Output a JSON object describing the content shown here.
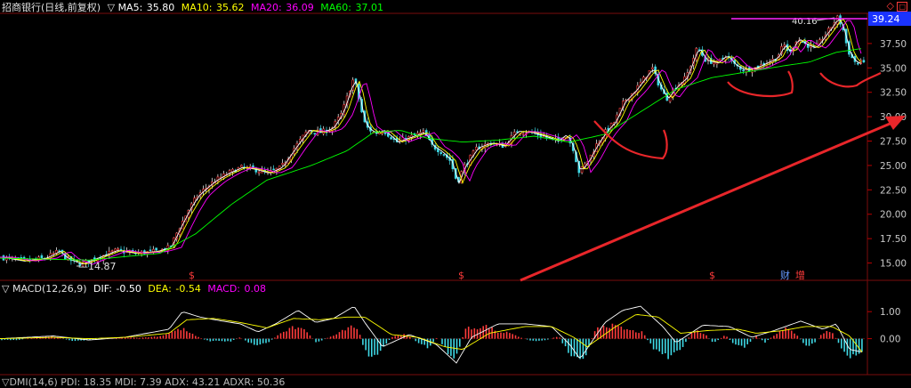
{
  "header": {
    "stock": "招商银行(日线,前复权)",
    "ma_toggle": "▽",
    "ma5_label": "MA5:",
    "ma5": "35.80",
    "ma10_label": "MA10:",
    "ma10": "35.62",
    "ma20_label": "MA20:",
    "ma20": "36.09",
    "ma60_label": "MA60:",
    "ma60": "37.01"
  },
  "macd_header": {
    "toggle": "▽",
    "name": "MACD(12,26,9)",
    "dif_label": "DIF:",
    "dif": "-0.50",
    "dea_label": "DEA:",
    "dea": "-0.54",
    "macd_label": "MACD:",
    "macd": "0.08"
  },
  "dmi_header": {
    "partial": "▽DMI(14,6) PDI: 18.35 MDI: 7.39 ADX: 43.21 ADXR: 50.36"
  },
  "price_box": "39.24",
  "high_label": "40.16",
  "low_label": "14.87",
  "markers": {
    "dividend": "$",
    "finance": "财",
    "increase": "增"
  },
  "colors": {
    "up": "#ff3b3b",
    "down": "#3fd9e6",
    "ma5": "#ffffff",
    "ma10": "#ffff00",
    "ma20": "#ff00ff",
    "ma60": "#00ff00",
    "dif": "#ffffff",
    "dea": "#ffff00",
    "annotation": "#e8262a",
    "grid": "#7a0b0b"
  },
  "chart_data": [
    {
      "type": "candlestick",
      "title": "招商银行(日线,前复权)",
      "ylim": [
        13.5,
        40.5
      ],
      "yticks": [
        15.0,
        17.5,
        20.0,
        22.5,
        25.0,
        27.5,
        30.0,
        32.5,
        35.0,
        37.5
      ],
      "ytick_labels": [
        "15.00",
        "17.50",
        "20.00",
        "22.50",
        "25.00",
        "27.50",
        "30.00",
        "32.50",
        "35.00",
        "37.50"
      ],
      "close_path": [
        [
          0,
          15.6
        ],
        [
          25,
          15.2
        ],
        [
          50,
          15.5
        ],
        [
          65,
          16.2
        ],
        [
          75,
          15.4
        ],
        [
          90,
          14.87
        ],
        [
          110,
          15.6
        ],
        [
          130,
          16.3
        ],
        [
          150,
          16.0
        ],
        [
          175,
          16.2
        ],
        [
          190,
          16.6
        ],
        [
          200,
          18.5
        ],
        [
          210,
          20.3
        ],
        [
          220,
          21.8
        ],
        [
          228,
          22.5
        ],
        [
          240,
          23.4
        ],
        [
          255,
          24.2
        ],
        [
          270,
          24.8
        ],
        [
          285,
          24.6
        ],
        [
          300,
          24.2
        ],
        [
          315,
          24.8
        ],
        [
          330,
          26.8
        ],
        [
          345,
          28.6
        ],
        [
          360,
          28.4
        ],
        [
          372,
          28.8
        ],
        [
          383,
          30.3
        ],
        [
          390,
          32.2
        ],
        [
          396,
          33.8
        ],
        [
          400,
          33.0
        ],
        [
          404,
          31.0
        ],
        [
          410,
          29.0
        ],
        [
          420,
          28.3
        ],
        [
          430,
          28.6
        ],
        [
          445,
          27.4
        ],
        [
          460,
          27.9
        ],
        [
          475,
          28.4
        ],
        [
          485,
          27.0
        ],
        [
          495,
          26.4
        ],
        [
          505,
          25.5
        ],
        [
          513,
          23.2
        ],
        [
          520,
          24.8
        ],
        [
          535,
          26.8
        ],
        [
          550,
          27.3
        ],
        [
          565,
          27.0
        ],
        [
          580,
          28.5
        ],
        [
          595,
          28.4
        ],
        [
          610,
          28.0
        ],
        [
          625,
          27.5
        ],
        [
          635,
          28.2
        ],
        [
          643,
          26.8
        ],
        [
          650,
          24.3
        ],
        [
          660,
          25.5
        ],
        [
          670,
          27.2
        ],
        [
          680,
          28.5
        ],
        [
          690,
          29.5
        ],
        [
          700,
          31.5
        ],
        [
          712,
          32.6
        ],
        [
          722,
          33.8
        ],
        [
          732,
          35.0
        ],
        [
          740,
          33.2
        ],
        [
          748,
          31.8
        ],
        [
          758,
          33.0
        ],
        [
          770,
          34.0
        ],
        [
          783,
          37.1
        ],
        [
          792,
          35.8
        ],
        [
          805,
          35.5
        ],
        [
          815,
          36.3
        ],
        [
          825,
          35.3
        ],
        [
          835,
          34.8
        ],
        [
          848,
          35.0
        ],
        [
          860,
          35.5
        ],
        [
          872,
          36.0
        ],
        [
          880,
          37.4
        ],
        [
          887,
          36.5
        ],
        [
          895,
          38.0
        ],
        [
          905,
          37.4
        ],
        [
          915,
          37.0
        ],
        [
          925,
          38.2
        ],
        [
          935,
          39.4
        ],
        [
          940,
          40.16
        ],
        [
          946,
          39.2
        ],
        [
          952,
          36.8
        ],
        [
          958,
          35.8
        ],
        [
          964,
          35.4
        ],
        [
          970,
          35.8
        ]
      ],
      "ma60_path": [
        [
          0,
          15.5
        ],
        [
          100,
          15.3
        ],
        [
          180,
          16.0
        ],
        [
          220,
          18.0
        ],
        [
          260,
          21.0
        ],
        [
          300,
          23.5
        ],
        [
          350,
          25.0
        ],
        [
          390,
          26.5
        ],
        [
          420,
          28.4
        ],
        [
          450,
          28.6
        ],
        [
          480,
          27.8
        ],
        [
          520,
          27.4
        ],
        [
          560,
          27.6
        ],
        [
          600,
          28.0
        ],
        [
          640,
          27.4
        ],
        [
          680,
          28.2
        ],
        [
          720,
          30.5
        ],
        [
          760,
          32.8
        ],
        [
          800,
          34.0
        ],
        [
          840,
          34.6
        ],
        [
          880,
          35.2
        ],
        [
          910,
          35.6
        ],
        [
          940,
          36.6
        ],
        [
          970,
          37.0
        ]
      ],
      "annotations": {
        "lowest": {
          "x_index": 90,
          "value": 14.87
        },
        "highest": {
          "x_index": 940,
          "value": 40.16
        },
        "last_price": 39.24
      }
    },
    {
      "type": "bar",
      "title": "MACD(12,26,9)",
      "ylim": [
        -1.2,
        1.6
      ],
      "yticks": [
        1.0,
        0.0
      ],
      "ytick_labels": [
        "1.00",
        "0.00"
      ],
      "series": [
        {
          "name": "DIF",
          "values": [
            [
              0,
              0.0
            ],
            [
              60,
              0.1
            ],
            [
              100,
              -0.05
            ],
            [
              140,
              0.05
            ],
            [
              190,
              0.35
            ],
            [
              205,
              1.0
            ],
            [
              225,
              0.8
            ],
            [
              250,
              0.65
            ],
            [
              270,
              0.55
            ],
            [
              290,
              0.25
            ],
            [
              310,
              0.55
            ],
            [
              335,
              1.05
            ],
            [
              355,
              0.6
            ],
            [
              375,
              0.75
            ],
            [
              398,
              1.2
            ],
            [
              410,
              0.6
            ],
            [
              430,
              -0.3
            ],
            [
              460,
              0.15
            ],
            [
              490,
              -0.2
            ],
            [
              513,
              -0.9
            ],
            [
              530,
              0.05
            ],
            [
              560,
              0.55
            ],
            [
              590,
              0.55
            ],
            [
              620,
              0.45
            ],
            [
              640,
              -0.2
            ],
            [
              652,
              -0.75
            ],
            [
              680,
              0.6
            ],
            [
              700,
              1.05
            ],
            [
              720,
              1.2
            ],
            [
              745,
              0.45
            ],
            [
              760,
              -0.15
            ],
            [
              790,
              0.5
            ],
            [
              820,
              0.45
            ],
            [
              845,
              0.05
            ],
            [
              870,
              0.3
            ],
            [
              900,
              0.65
            ],
            [
              925,
              0.35
            ],
            [
              940,
              0.55
            ],
            [
              955,
              -0.4
            ],
            [
              970,
              -0.5
            ]
          ]
        },
        {
          "name": "DEA",
          "values": [
            [
              0,
              0.0
            ],
            [
              60,
              0.05
            ],
            [
              100,
              0.0
            ],
            [
              140,
              0.05
            ],
            [
              190,
              0.2
            ],
            [
              210,
              0.7
            ],
            [
              240,
              0.75
            ],
            [
              270,
              0.6
            ],
            [
              300,
              0.4
            ],
            [
              330,
              0.75
            ],
            [
              360,
              0.7
            ],
            [
              390,
              0.8
            ],
            [
              410,
              0.8
            ],
            [
              440,
              0.15
            ],
            [
              470,
              0.05
            ],
            [
              500,
              -0.3
            ],
            [
              520,
              -0.4
            ],
            [
              550,
              0.2
            ],
            [
              590,
              0.45
            ],
            [
              620,
              0.45
            ],
            [
              645,
              0.05
            ],
            [
              660,
              -0.3
            ],
            [
              690,
              0.4
            ],
            [
              715,
              0.9
            ],
            [
              740,
              0.8
            ],
            [
              765,
              0.2
            ],
            [
              795,
              0.3
            ],
            [
              830,
              0.35
            ],
            [
              850,
              0.2
            ],
            [
              880,
              0.3
            ],
            [
              905,
              0.45
            ],
            [
              935,
              0.45
            ],
            [
              955,
              0.1
            ],
            [
              970,
              -0.54
            ]
          ]
        }
      ],
      "histogram": [
        [
          20,
          -0.05
        ],
        [
          40,
          0.06
        ],
        [
          60,
          0.08
        ],
        [
          80,
          -0.08
        ],
        [
          100,
          -0.06
        ],
        [
          120,
          0.02
        ],
        [
          140,
          0.05
        ],
        [
          160,
          0.04
        ],
        [
          180,
          0.1
        ],
        [
          195,
          0.3
        ],
        [
          205,
          0.4
        ],
        [
          220,
          0.1
        ],
        [
          235,
          -0.1
        ],
        [
          245,
          -0.08
        ],
        [
          258,
          -0.12
        ],
        [
          270,
          0.05
        ],
        [
          285,
          -0.25
        ],
        [
          300,
          -0.18
        ],
        [
          315,
          0.2
        ],
        [
          330,
          0.45
        ],
        [
          345,
          0.3
        ],
        [
          355,
          -0.15
        ],
        [
          370,
          0.05
        ],
        [
          383,
          0.3
        ],
        [
          395,
          0.55
        ],
        [
          403,
          0.35
        ],
        [
          410,
          -0.55
        ],
        [
          418,
          -0.65
        ],
        [
          428,
          -0.5
        ],
        [
          440,
          0.05
        ],
        [
          455,
          0.2
        ],
        [
          470,
          -0.15
        ],
        [
          482,
          -0.4
        ],
        [
          492,
          0.1
        ],
        [
          503,
          -0.55
        ],
        [
          513,
          -0.8
        ],
        [
          523,
          0.4
        ],
        [
          535,
          0.45
        ],
        [
          548,
          0.5
        ],
        [
          560,
          0.25
        ],
        [
          573,
          0.25
        ],
        [
          585,
          0.05
        ],
        [
          600,
          -0.1
        ],
        [
          615,
          -0.05
        ],
        [
          628,
          0.1
        ],
        [
          638,
          -0.5
        ],
        [
          648,
          -0.8
        ],
        [
          658,
          -0.65
        ],
        [
          670,
          0.45
        ],
        [
          680,
          0.55
        ],
        [
          690,
          0.5
        ],
        [
          700,
          0.4
        ],
        [
          712,
          0.3
        ],
        [
          722,
          0.25
        ],
        [
          734,
          -0.35
        ],
        [
          745,
          -0.6
        ],
        [
          755,
          -0.75
        ],
        [
          765,
          -0.45
        ],
        [
          780,
          0.35
        ],
        [
          792,
          0.2
        ],
        [
          802,
          -0.2
        ],
        [
          815,
          0.15
        ],
        [
          826,
          -0.25
        ],
        [
          838,
          -0.35
        ],
        [
          850,
          0.1
        ],
        [
          860,
          -0.15
        ],
        [
          872,
          0.2
        ],
        [
          884,
          0.4
        ],
        [
          895,
          0.2
        ],
        [
          905,
          -0.3
        ],
        [
          915,
          -0.2
        ],
        [
          925,
          0.25
        ],
        [
          935,
          0.3
        ],
        [
          945,
          -0.35
        ],
        [
          955,
          -0.7
        ],
        [
          962,
          -0.8
        ],
        [
          970,
          -0.55
        ]
      ]
    }
  ]
}
